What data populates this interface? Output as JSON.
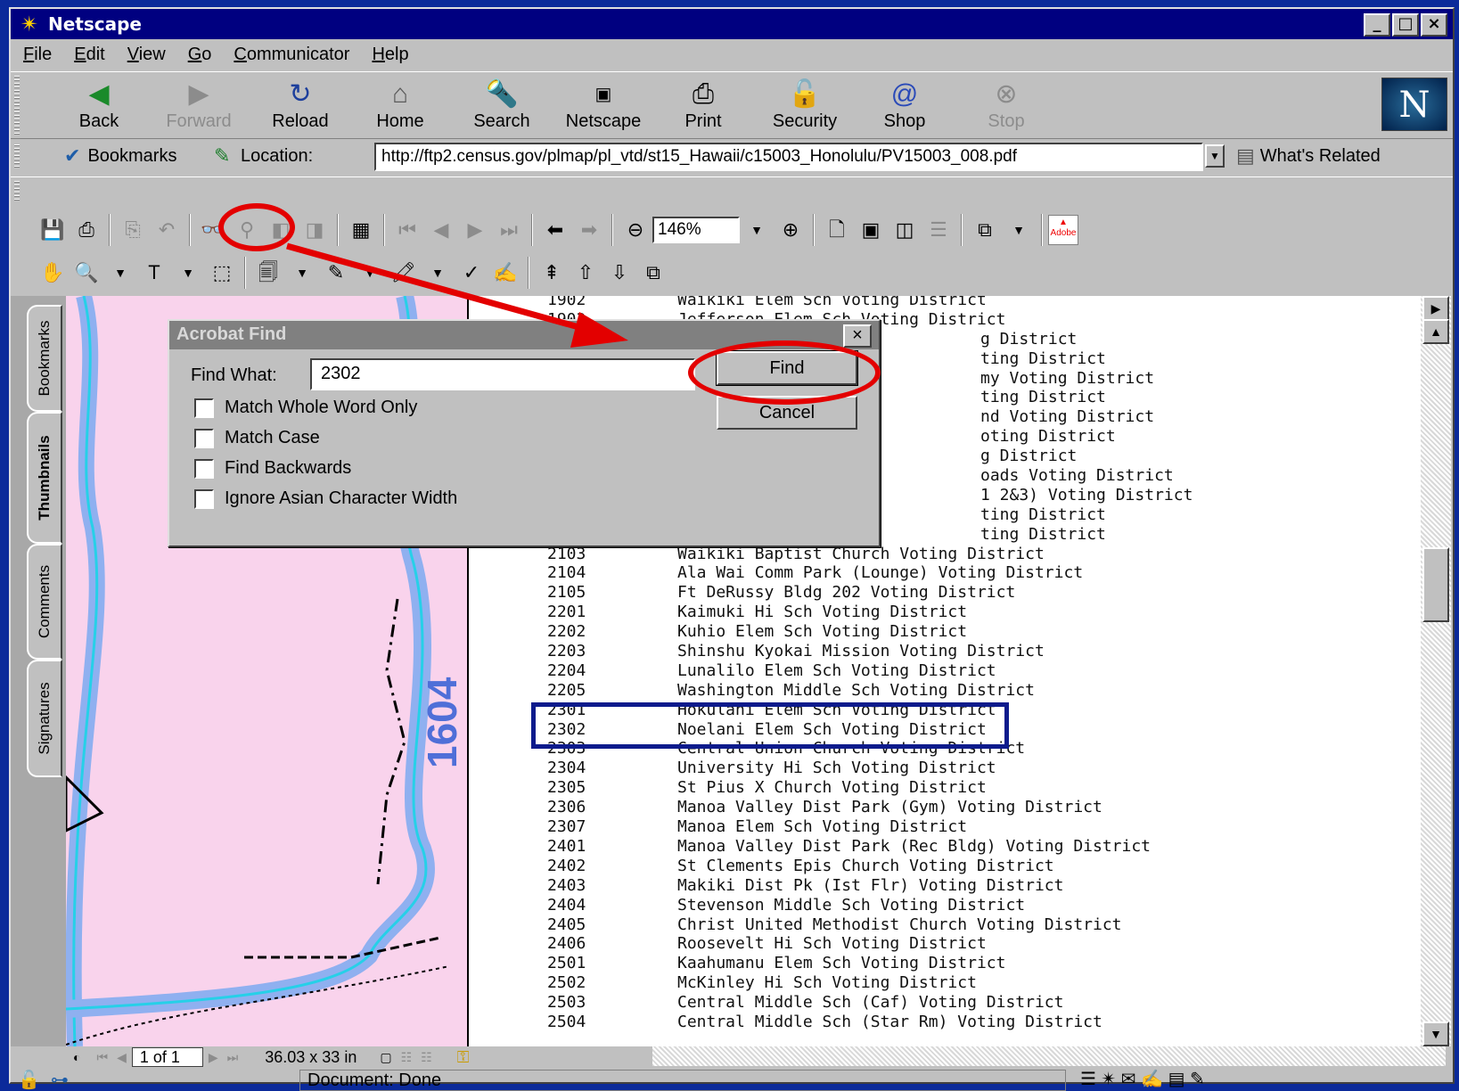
{
  "window": {
    "title": "Netscape"
  },
  "menu": [
    "File",
    "Edit",
    "View",
    "Go",
    "Communicator",
    "Help"
  ],
  "nav_buttons": [
    {
      "label": "Back",
      "icon": "back-arrow-icon",
      "enabled": true
    },
    {
      "label": "Forward",
      "icon": "forward-arrow-icon",
      "enabled": false
    },
    {
      "label": "Reload",
      "icon": "reload-icon",
      "enabled": true
    },
    {
      "label": "Home",
      "icon": "home-icon",
      "enabled": true
    },
    {
      "label": "Search",
      "icon": "search-icon",
      "enabled": true
    },
    {
      "label": "Netscape",
      "icon": "my-netscape-icon",
      "enabled": true
    },
    {
      "label": "Print",
      "icon": "print-icon",
      "enabled": true
    },
    {
      "label": "Security",
      "icon": "security-lock-icon",
      "enabled": true
    },
    {
      "label": "Shop",
      "icon": "shop-icon",
      "enabled": true
    },
    {
      "label": "Stop",
      "icon": "stop-icon",
      "enabled": false
    }
  ],
  "location": {
    "bookmarks_label": "Bookmarks",
    "location_label": "Location:",
    "url": "http://ftp2.census.gov/plmap/pl_vtd/st15_Hawaii/c15003_Honolulu/PV15003_008.pdf",
    "related_label": "What's Related"
  },
  "acrobat": {
    "zoom": "146%"
  },
  "side_tabs": [
    "Bookmarks",
    "Thumbnails",
    "Comments",
    "Signatures"
  ],
  "map": {
    "label": "1604"
  },
  "districts": [
    {
      "code": "1902",
      "name": "Waikiki Elem Sch Voting District"
    },
    {
      "code": "1903",
      "name": "Jefferson Elem Sch Voting District"
    },
    {
      "code": "",
      "name": "g District"
    },
    {
      "code": "",
      "name": "ting District"
    },
    {
      "code": "",
      "name": "my Voting District"
    },
    {
      "code": "",
      "name": "ting District"
    },
    {
      "code": "",
      "name": "nd Voting District"
    },
    {
      "code": "",
      "name": "oting District"
    },
    {
      "code": "",
      "name": "g District"
    },
    {
      "code": "",
      "name": "oads Voting District"
    },
    {
      "code": "",
      "name": "1 2&3) Voting District"
    },
    {
      "code": "",
      "name": "ting District"
    },
    {
      "code": "",
      "name": "ting District"
    },
    {
      "code": "2103",
      "name": "Waikiki Baptist Church Voting District"
    },
    {
      "code": "2104",
      "name": "Ala Wai Comm Park (Lounge) Voting District"
    },
    {
      "code": "2105",
      "name": "Ft DeRussy Bldg 202 Voting District"
    },
    {
      "code": "2201",
      "name": "Kaimuki Hi Sch Voting District"
    },
    {
      "code": "2202",
      "name": "Kuhio Elem Sch Voting District"
    },
    {
      "code": "2203",
      "name": "Shinshu Kyokai Mission Voting District"
    },
    {
      "code": "2204",
      "name": "Lunalilo Elem Sch Voting District"
    },
    {
      "code": "2205",
      "name": "Washington Middle Sch Voting District"
    },
    {
      "code": "2301",
      "name": "Hokulani Elem Sch Voting District"
    },
    {
      "code": "2302",
      "name": "Noelani Elem Sch Voting District"
    },
    {
      "code": "2303",
      "name": "Central Union Church Voting District"
    },
    {
      "code": "2304",
      "name": "University Hi Sch Voting District"
    },
    {
      "code": "2305",
      "name": "St Pius X Church Voting District"
    },
    {
      "code": "2306",
      "name": "Manoa Valley Dist Park (Gym) Voting District"
    },
    {
      "code": "2307",
      "name": "Manoa Elem Sch Voting District"
    },
    {
      "code": "2401",
      "name": "Manoa Valley Dist Park (Rec Bldg) Voting District"
    },
    {
      "code": "2402",
      "name": "St Clements Epis Church Voting District"
    },
    {
      "code": "2403",
      "name": "Makiki Dist Pk (Ist Flr) Voting District"
    },
    {
      "code": "2404",
      "name": "Stevenson Middle Sch Voting District"
    },
    {
      "code": "2405",
      "name": "Christ United Methodist Church Voting District"
    },
    {
      "code": "2406",
      "name": "Roosevelt Hi Sch Voting District"
    },
    {
      "code": "2501",
      "name": "Kaahumanu Elem Sch Voting District"
    },
    {
      "code": "2502",
      "name": "McKinley Hi Sch Voting District"
    },
    {
      "code": "2503",
      "name": "Central Middle Sch (Caf) Voting District"
    },
    {
      "code": "2504",
      "name": "Central Middle Sch (Star Rm) Voting District"
    }
  ],
  "dialog": {
    "title": "Acrobat Find",
    "find_label": "Find What:",
    "find_value": "2302",
    "options": [
      "Match Whole Word Only",
      "Match Case",
      "Find Backwards",
      "Ignore Asian Character Width"
    ],
    "find_button": "Find",
    "cancel_button": "Cancel"
  },
  "doc_status": {
    "page": "1 of 1",
    "size": "36.03 x 33 in"
  },
  "status": {
    "text": "Document: Done"
  },
  "colors": {
    "annotation_red": "#e30000",
    "highlight_blue": "#0d1b8c",
    "title_bar": "#000080"
  }
}
